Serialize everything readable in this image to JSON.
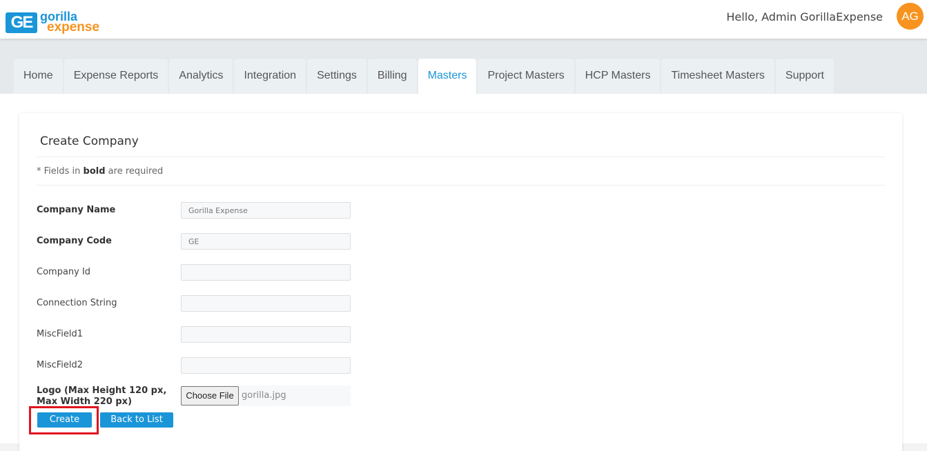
{
  "header": {
    "logo_mark": "GE",
    "logo_word1": "gorilla",
    "logo_word2": "expense",
    "greeting": "Hello, Admin GorillaExpense",
    "avatar_initials": "AG"
  },
  "nav": {
    "tabs": [
      {
        "label": "Home"
      },
      {
        "label": "Expense Reports"
      },
      {
        "label": "Analytics"
      },
      {
        "label": "Integration"
      },
      {
        "label": "Settings"
      },
      {
        "label": "Billing"
      },
      {
        "label": "Masters"
      },
      {
        "label": "Project Masters"
      },
      {
        "label": "HCP Masters"
      },
      {
        "label": "Timesheet Masters"
      },
      {
        "label": "Support"
      }
    ],
    "active_tab": "Masters"
  },
  "form": {
    "title": "Create Company",
    "required_note_prefix": "* Fields in ",
    "required_note_bold": "bold",
    "required_note_suffix": " are required",
    "fields": [
      {
        "label": "Company Name",
        "value": "Gorilla Expense",
        "required": true
      },
      {
        "label": "Company Code",
        "value": "GE",
        "required": true
      },
      {
        "label": "Company Id",
        "value": "",
        "required": false
      },
      {
        "label": "Connection String",
        "value": "",
        "required": false
      },
      {
        "label": "MiscField1",
        "value": "",
        "required": false
      },
      {
        "label": "MiscField2",
        "value": "",
        "required": false
      }
    ],
    "logo": {
      "label": "Logo (Max Height 120 px, Max Width 220 px)",
      "button_label": "Choose File",
      "file_name": "gorilla.jpg"
    },
    "buttons": {
      "create": "Create",
      "back": "Back to List"
    }
  },
  "colors": {
    "primary": "#1a95d8",
    "accent": "#f7931e",
    "highlight": "#e0131f"
  }
}
